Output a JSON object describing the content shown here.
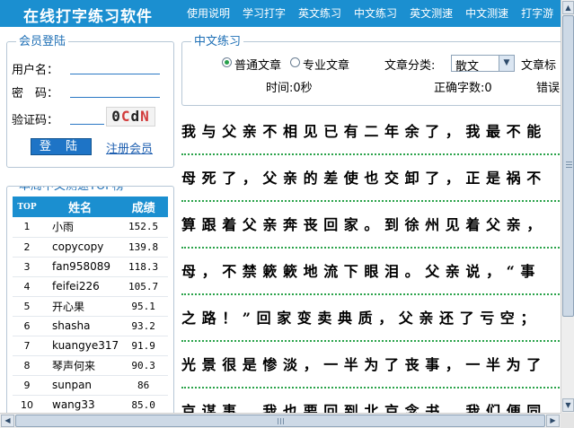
{
  "header": {
    "logo": "在线打字练习软件",
    "nav": [
      "使用说明",
      "学习打字",
      "英文练习",
      "中文练习",
      "英文测速",
      "中文测速",
      "打字游"
    ]
  },
  "login": {
    "legend": "会员登陆",
    "username_label": "用户名：",
    "password_label": "密　码：",
    "captcha_label": "验证码：",
    "captcha_chars": [
      "0",
      "C",
      "d",
      "N"
    ],
    "login_button": "登 陆",
    "register_link": "注册会员"
  },
  "ranking": {
    "legend": "本周中文测速TOP榜",
    "headers": {
      "top": "TOP",
      "name": "姓名",
      "score": "成绩"
    },
    "rows": [
      {
        "top": "1",
        "name": "小雨",
        "score": "152.5"
      },
      {
        "top": "2",
        "name": "copycopy",
        "score": "139.8"
      },
      {
        "top": "3",
        "name": "fan958089",
        "score": "118.3"
      },
      {
        "top": "4",
        "name": "feifei226",
        "score": "105.7"
      },
      {
        "top": "5",
        "name": "开心果",
        "score": "95.1"
      },
      {
        "top": "6",
        "name": "shasha",
        "score": "93.2"
      },
      {
        "top": "7",
        "name": "kuangye317",
        "score": "91.9"
      },
      {
        "top": "8",
        "name": "琴声何来",
        "score": "90.3"
      },
      {
        "top": "9",
        "name": "sunpan",
        "score": "86"
      },
      {
        "top": "10",
        "name": "wang33",
        "score": "85.0"
      }
    ]
  },
  "practice": {
    "legend": "中文练习",
    "radio_normal": "普通文章",
    "radio_pro": "专业文章",
    "category_label": "文章分类:",
    "category_value": "散文",
    "title_label": "文章标",
    "time_label": "时间:0秒",
    "correct_label": "正确字数:0",
    "error_label": "错误"
  },
  "text_lines": [
    "我与父亲不相见已有二年余了，我最不能",
    "母死了，父亲的差使也交卸了，正是祸不",
    "算跟着父亲奔丧回家。到徐州见着父亲，",
    "母，不禁簌簌地流下眼泪。父亲说，“事",
    "之路！”回家变卖典质，父亲还了亏空；",
    "光景很是惨淡，一半为了丧事，一半为了",
    "京谋事，我也要回到北京念书，我们便同"
  ]
}
